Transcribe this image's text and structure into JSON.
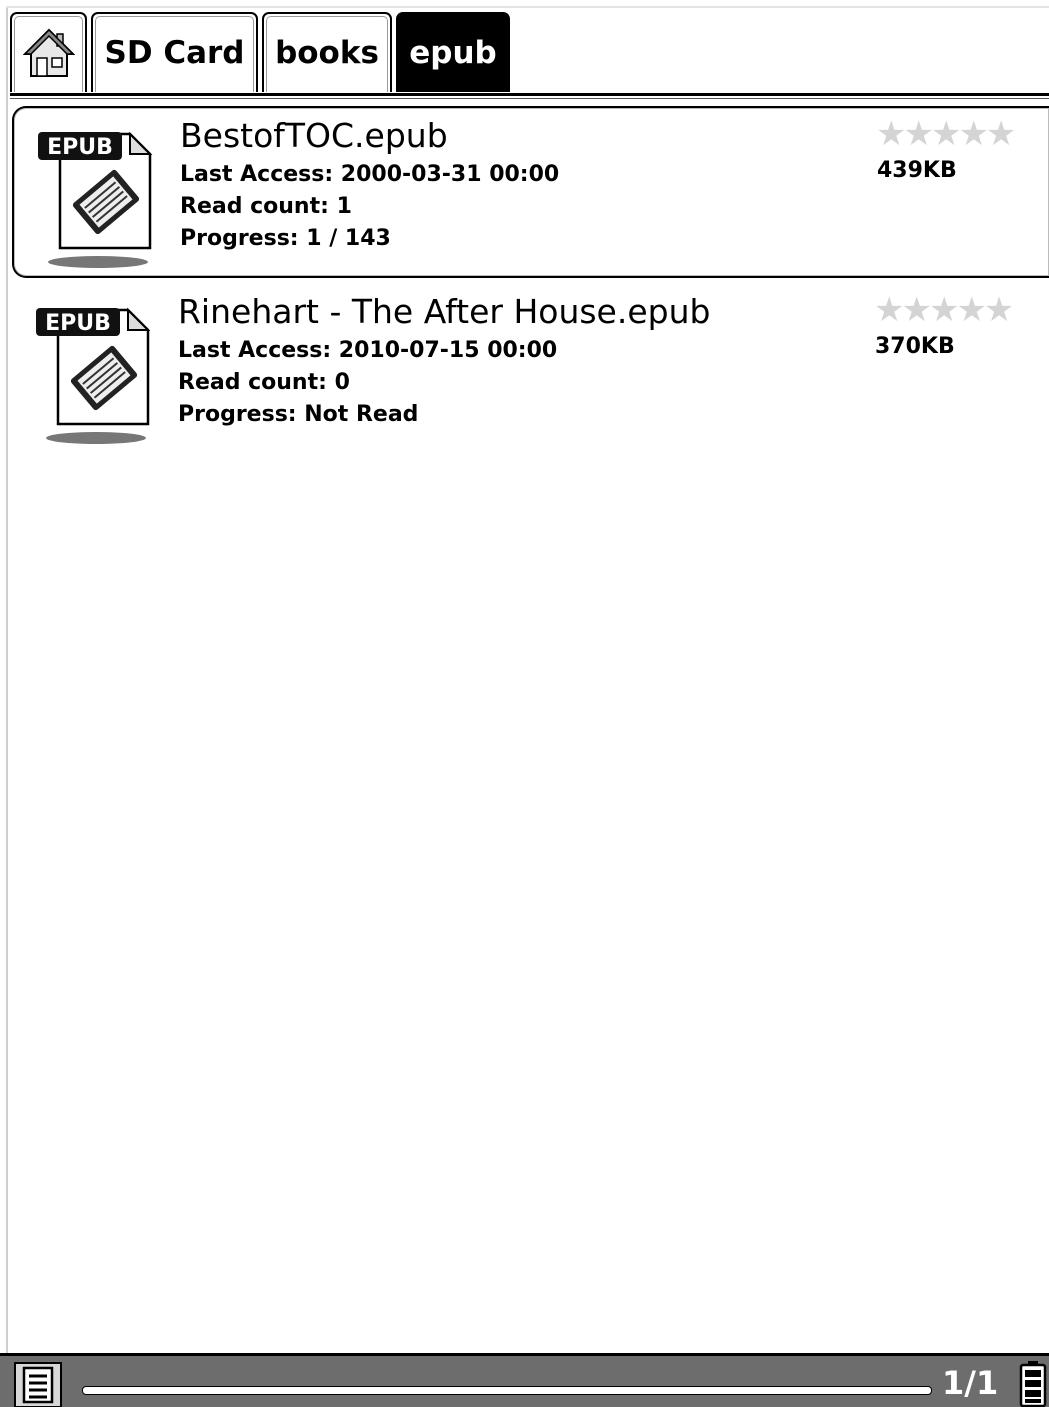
{
  "breadcrumb": {
    "home_icon": "home-icon",
    "items": [
      {
        "label": "SD Card"
      },
      {
        "label": "books"
      },
      {
        "label": "epub",
        "active": true
      }
    ]
  },
  "files": [
    {
      "icon": "epub-file-icon",
      "icon_badge": "EPUB",
      "title": "BestofTOC.epub",
      "last_access": "Last Access: 2000-03-31 00:00",
      "read_count": "Read count: 1",
      "progress": "Progress: 1 / 143",
      "rating_stars": "★★★★★",
      "rating": 0,
      "size": "439KB",
      "selected": true
    },
    {
      "icon": "epub-file-icon",
      "icon_badge": "EPUB",
      "title": "Rinehart - The After House.epub",
      "last_access": "Last Access: 2010-07-15 00:00",
      "read_count": "Read count: 0",
      "progress": "Progress: Not Read",
      "rating_stars": "★★★★★",
      "rating": 0,
      "size": "370KB",
      "selected": false
    }
  ],
  "status_bar": {
    "menu_icon": "menu-icon",
    "page_indicator": "1/1",
    "battery_icon": "battery-icon"
  },
  "colors": {
    "background": "#ffffff",
    "active_tab": "#000000",
    "status_bar": "#6d6d6d",
    "star_empty": "#d4d4d4"
  }
}
